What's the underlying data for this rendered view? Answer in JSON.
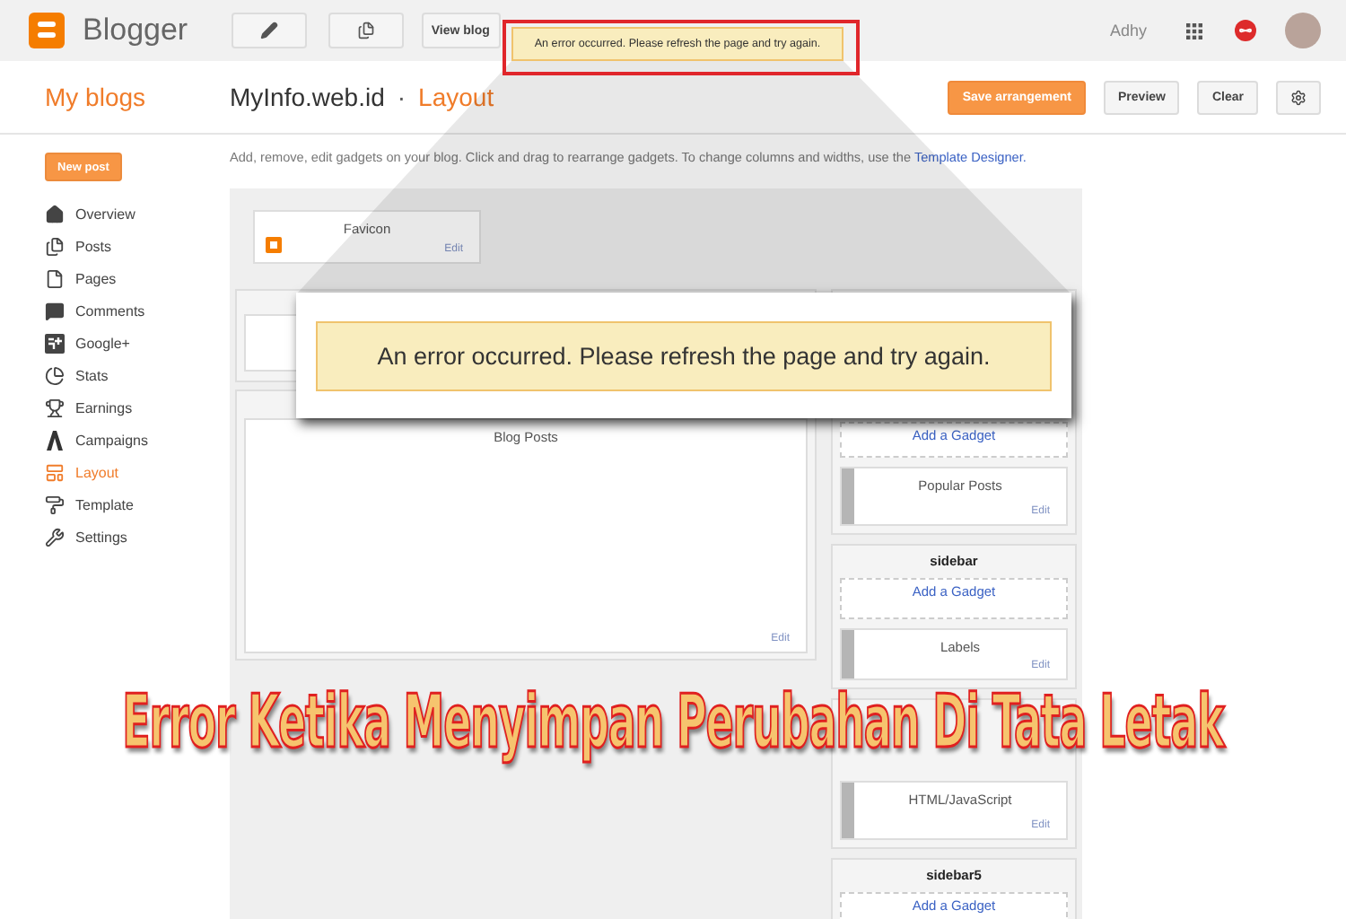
{
  "topbar": {
    "brand": "Blogger",
    "view_blog": "View blog",
    "user": "Adhy"
  },
  "toast": {
    "message": "An error occurred. Please refresh the page and try again."
  },
  "callout": {
    "message": "An error occurred. Please refresh the page and try again."
  },
  "header": {
    "my_blogs": "My blogs",
    "blog_name": "MyInfo.web.id",
    "separator": "·",
    "page": "Layout",
    "buttons": [
      "Save arrangement",
      "Preview",
      "Clear"
    ]
  },
  "nav": {
    "new_post": "New post",
    "items": [
      {
        "label": "Overview",
        "selected": false
      },
      {
        "label": "Posts",
        "selected": false
      },
      {
        "label": "Pages",
        "selected": false
      },
      {
        "label": "Comments",
        "selected": false
      },
      {
        "label": "Google+",
        "selected": false
      },
      {
        "label": "Stats",
        "selected": false
      },
      {
        "label": "Earnings",
        "selected": false
      },
      {
        "label": "Campaigns",
        "selected": false
      },
      {
        "label": "Layout",
        "selected": true
      },
      {
        "label": "Template",
        "selected": false
      },
      {
        "label": "Settings",
        "selected": false
      }
    ]
  },
  "intro": {
    "text": "Add, remove, edit gadgets on your blog. Click and drag to rearrange gadgets. To change columns and widths, use the",
    "link": "Template Designer."
  },
  "layout": {
    "favicon": {
      "title": "Favicon",
      "edit": "Edit"
    },
    "main_sections": [
      {
        "gadgets": [
          {
            "title": "Blog Posts",
            "edit": "Edit"
          }
        ]
      }
    ],
    "sidebar_sections": [
      {
        "add_gadget": "Add a Gadget",
        "gadgets": [
          {
            "title": "Popular Posts",
            "edit": "Edit"
          }
        ]
      },
      {
        "title": "sidebar",
        "add_gadget": "Add a Gadget",
        "gadgets": [
          {
            "title": "Labels",
            "edit": "Edit"
          }
        ]
      },
      {
        "gadgets": [
          {
            "title": "HTML/JavaScript",
            "edit": "Edit"
          }
        ]
      },
      {
        "title": "sidebar5",
        "add_gadget": "Add a Gadget"
      }
    ]
  },
  "overlay_title": "Error Ketika Menyimpan Perubahan Di Tata Letak"
}
